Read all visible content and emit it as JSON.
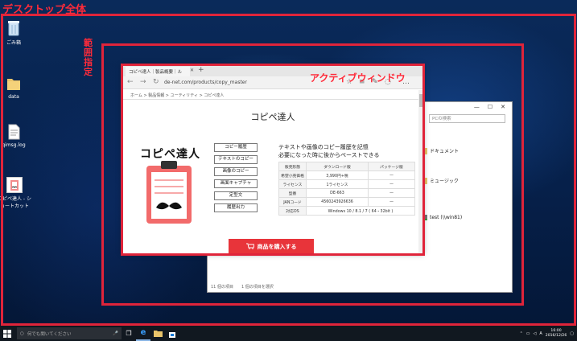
{
  "overlay": {
    "desktop_label": "デスクトップ全体",
    "range_label": "範囲指定",
    "active_window_label": "アクティブウィンドウ",
    "frame_color": "#e0243a"
  },
  "desktop_icons": [
    {
      "label": "ごみ箱",
      "icon": "recycle-bin-icon"
    },
    {
      "label": "data",
      "icon": "folder-icon"
    },
    {
      "label": "qimsg.log",
      "icon": "text-file-icon"
    },
    {
      "label": "コピペ達人 ‐ ショートカット",
      "icon": "app-shortcut-icon"
    }
  ],
  "explorer": {
    "search_placeholder": "PCの検索",
    "items": [
      {
        "label": "ドキュメント",
        "icon": "documents-folder-icon"
      },
      {
        "label": "ミュージック",
        "icon": "music-folder-icon"
      },
      {
        "label": "test (\\\\win81)",
        "icon": "network-drive-icon"
      }
    ],
    "status_left": "11 個の項目",
    "status_right": "1 個の項目を選択"
  },
  "browser": {
    "tab_title": "コピペ達人｜製品概要｜ル",
    "url": "de-net.com/products/copy_master",
    "breadcrumb": "ホーム  >  製品情報  >  ユーティリティ  >  コピペ達人",
    "product_title": "コピペ達人",
    "logo_text": "コピペ達人",
    "menu_buttons": [
      "コピー履歴",
      "テキストのコピー",
      "画像のコピー",
      "画面キャプチャ",
      "定型文",
      "履歴出力"
    ],
    "description_line1": "テキストや画像のコピー履歴を記憶",
    "description_line2": "必要になった時に後からペーストできる",
    "spec_table": {
      "headers": [
        "販売形態",
        "ダウンロード版",
        "パッケージ版"
      ],
      "rows": [
        [
          "希望小売価格",
          "3,990円+税",
          "—"
        ],
        [
          "ライセンス",
          "1ライセンス",
          "—"
        ],
        [
          "型番",
          "DE-663",
          "—"
        ],
        [
          "JANコード",
          "4560243926636",
          "—"
        ],
        [
          "対応OS",
          "Windows 10 / 8.1 / 7 ( 64・32bit )",
          ""
        ]
      ]
    },
    "buy_button": "商品を購入する",
    "accent_color": "#e8343a"
  },
  "taskbar": {
    "search_placeholder": "何でも聞いてください",
    "ime_indicator": "A",
    "time": "16:00",
    "date": "2016/12/26"
  }
}
